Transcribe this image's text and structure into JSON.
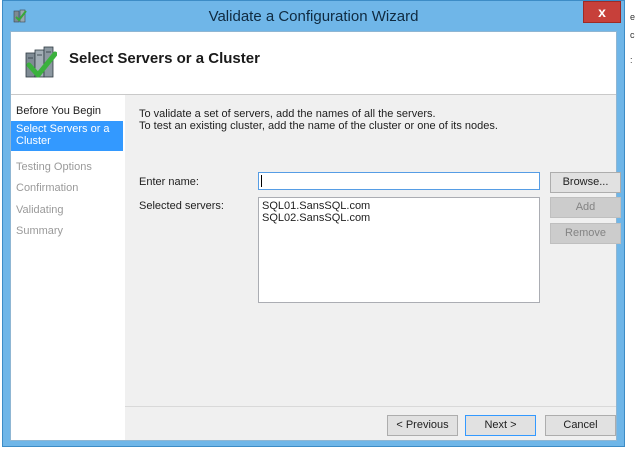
{
  "window": {
    "title": "Validate a Configuration Wizard",
    "close_glyph": "x"
  },
  "header": {
    "title": "Select Servers or a Cluster"
  },
  "nav": {
    "items": [
      {
        "label": "Before You Begin",
        "state": "done"
      },
      {
        "label": "Select Servers or a Cluster",
        "state": "active"
      },
      {
        "label": "Testing Options",
        "state": "pending"
      },
      {
        "label": "Confirmation",
        "state": "pending"
      },
      {
        "label": "Validating",
        "state": "pending"
      },
      {
        "label": "Summary",
        "state": "pending"
      }
    ]
  },
  "main": {
    "intro_line1": "To validate a set of servers, add the names of all the servers.",
    "intro_line2": "To test an existing cluster, add the name of the cluster or one of its nodes.",
    "enter_name_label": "Enter name:",
    "enter_name_value": "",
    "selected_servers_label": "Selected servers:",
    "selected_servers": [
      "SQL01.SansSQL.com",
      "SQL02.SansSQL.com"
    ],
    "browse_label": "Browse...",
    "add_label": "Add",
    "remove_label": "Remove"
  },
  "footer": {
    "previous_label": "< Previous",
    "next_label": "Next >",
    "cancel_label": "Cancel"
  },
  "colors": {
    "titlebar": "#6fb6e8",
    "selection": "#3399ff",
    "close_button": "#c7403a"
  },
  "icons": {
    "app": "cluster-wizard-icon",
    "header": "server-checkmark-icon"
  }
}
